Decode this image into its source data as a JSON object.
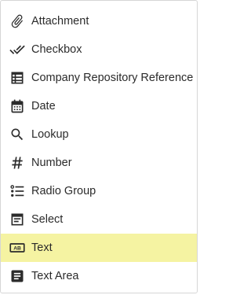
{
  "menu": {
    "items": [
      {
        "label": "Attachment",
        "icon": "paperclip-icon"
      },
      {
        "label": "Checkbox",
        "icon": "double-check-icon"
      },
      {
        "label": "Company Repository Reference",
        "icon": "table-icon"
      },
      {
        "label": "Date",
        "icon": "calendar-icon"
      },
      {
        "label": "Lookup",
        "icon": "search-icon"
      },
      {
        "label": "Number",
        "icon": "hash-icon"
      },
      {
        "label": "Radio Group",
        "icon": "radio-list-icon"
      },
      {
        "label": "Select",
        "icon": "select-list-icon"
      },
      {
        "label": "Text",
        "icon": "text-ab-icon",
        "highlighted": true
      },
      {
        "label": "Text Area",
        "icon": "text-area-icon"
      }
    ]
  },
  "colors": {
    "highlight": "#f5f3a2",
    "icon": "#2b2b2b",
    "text": "#2b2b2b",
    "border": "#d6d6d6"
  }
}
